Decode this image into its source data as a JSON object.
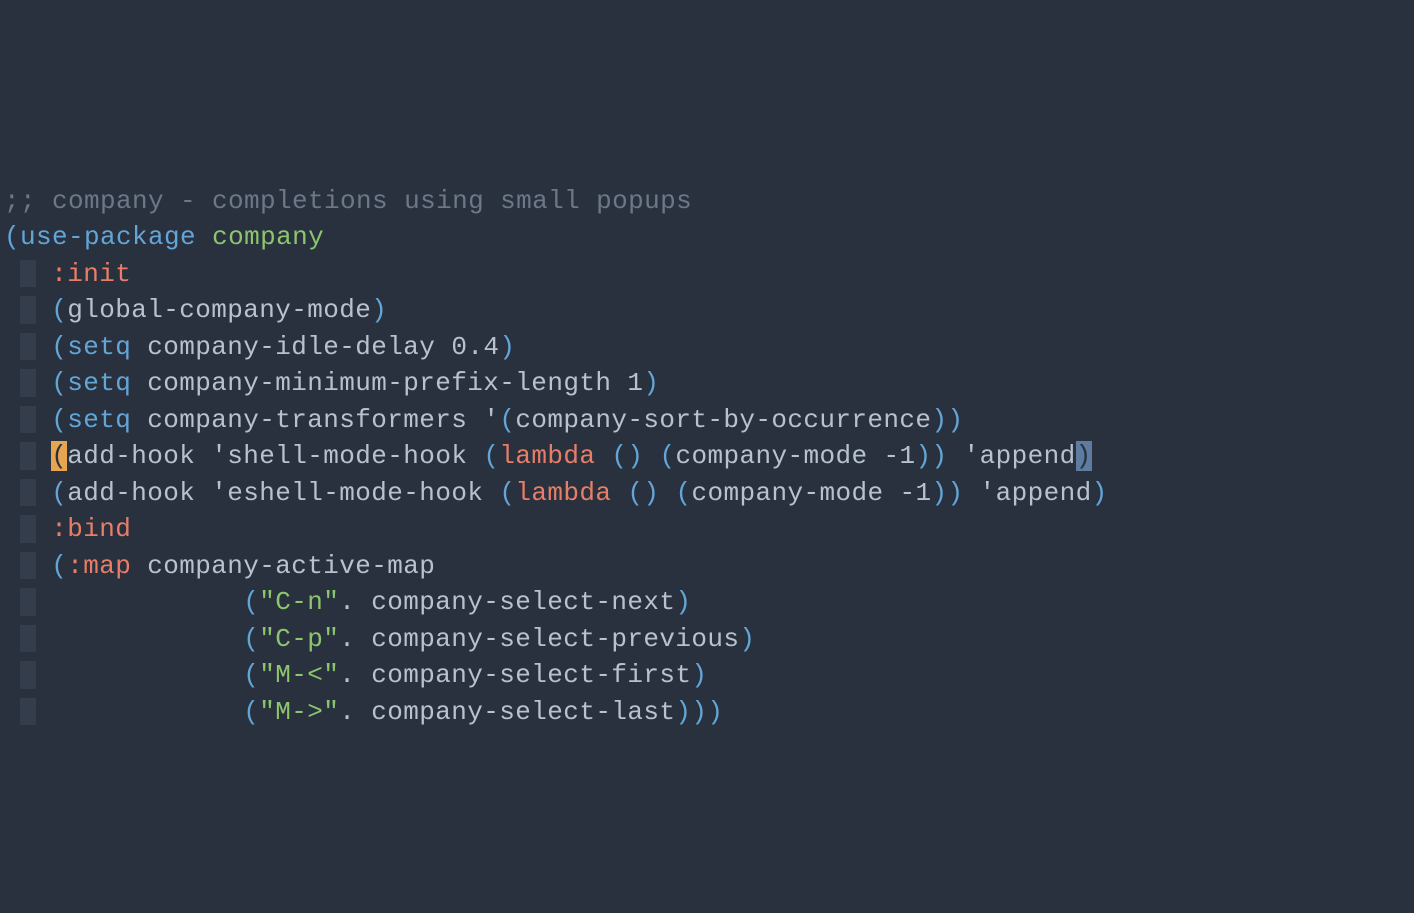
{
  "code": {
    "comment": ";; company - completions using small popups",
    "use_package": "use-package",
    "package_name": "company",
    "init_key": ":init",
    "global_fn": "global-company-mode",
    "setq1_fn": "setq",
    "setq1_var": "company-idle-delay",
    "setq1_val": "0.4",
    "setq2_fn": "setq",
    "setq2_var": "company-minimum-prefix-length",
    "setq2_val": "1",
    "setq3_fn": "setq",
    "setq3_var": "company-transformers",
    "setq3_q": "'",
    "setq3_item": "company-sort-by-occurrence",
    "hook1_fn": "add-hook",
    "hook1_q": "'",
    "hook1_name": "shell-mode-hook",
    "hook1_lambda": "lambda",
    "hook1_body": "company-mode -1",
    "hook1_qa": "'",
    "hook1_append": "append",
    "hook2_fn": "add-hook",
    "hook2_q": "'",
    "hook2_name": "eshell-mode-hook",
    "hook2_lambda": "lambda",
    "hook2_body": "company-mode -1",
    "hook2_qa": "'",
    "hook2_append": "append",
    "bind_key": ":bind",
    "map_key": ":map",
    "map_name": "company-active-map",
    "bind1_key": "\"C-n\"",
    "bind1_fn": "company-select-next",
    "bind2_key": "\"C-p\"",
    "bind2_fn": "company-select-previous",
    "bind3_key": "\"M-<\"",
    "bind3_fn": "company-select-first",
    "bind4_key": "\"M->\"",
    "bind4_fn": "company-select-last"
  }
}
